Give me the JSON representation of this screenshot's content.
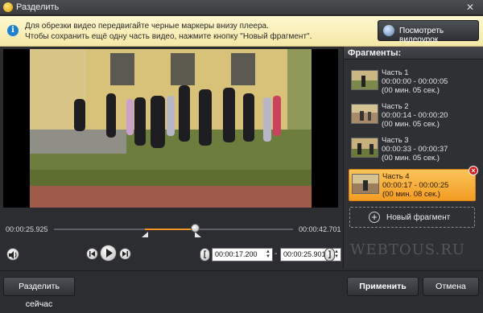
{
  "window": {
    "title": "Разделить",
    "close_glyph": "✕"
  },
  "info": {
    "line1": "Для обрезки видео передвигайте черные маркеры внизу плеера.",
    "line2": "Чтобы сохранить ещё одну часть видео, нажмите кнопку \"Новый фрагмент\".",
    "icon": "info-icon",
    "video_lesson_label": "Посмотреть видеоурок"
  },
  "fragments": {
    "header": "Фрагменты:",
    "items": [
      {
        "name": "Часть 1",
        "range": "00:00:00 - 00:00:05",
        "duration": "(00 мин. 05 сек.)",
        "selected": false
      },
      {
        "name": "Часть 2",
        "range": "00:00:14 - 00:00:20",
        "duration": "(00 мин. 05 сек.)",
        "selected": false
      },
      {
        "name": "Часть 3",
        "range": "00:00:33 - 00:00:37",
        "duration": "(00 мин. 05 сек.)",
        "selected": false
      },
      {
        "name": "Часть 4",
        "range": "00:00:17 - 00:00:25",
        "duration": "(00 мин. 08 сек.)",
        "selected": true
      }
    ],
    "delete_glyph": "×",
    "new_fragment_label": "Новый фрагмент"
  },
  "timeline": {
    "current_time": "00:00:25.925",
    "total_time": "00:00:42.701",
    "selection_start_fraction": 0.38,
    "selection_end_fraction": 0.59,
    "playhead_fraction": 0.59
  },
  "controls": {
    "start_time": "00:00:17.200",
    "end_time": "00:00:25.901",
    "range_dash": "-",
    "spin_up": "▲",
    "spin_down": "▼",
    "bracket_left": "[",
    "bracket_right": "]"
  },
  "bottom": {
    "split_now_label": "Разделить сейчас",
    "apply_label": "Применить",
    "cancel_label": "Отмена"
  },
  "watermark": "WEBTOUS.RU",
  "colors": {
    "accent": "#f39323",
    "selected_fragment": "#f8b445",
    "info_bar": "#f8eebb"
  }
}
